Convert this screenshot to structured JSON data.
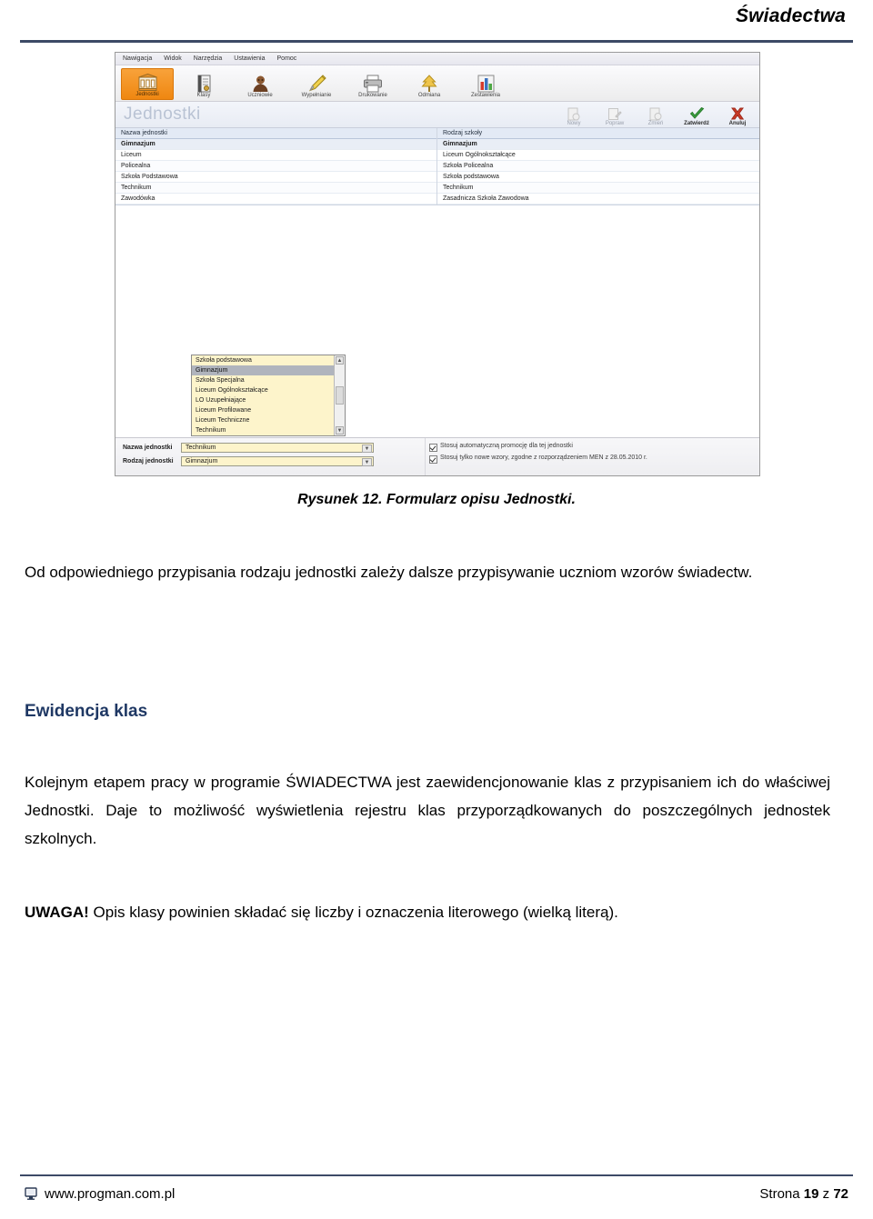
{
  "header": {
    "title": "Świadectwa"
  },
  "figure": {
    "menubar": [
      "Nawigacja",
      "Widok",
      "Narzędzia",
      "Ustawienia",
      "Pomoc"
    ],
    "toolbar": [
      {
        "label": "Jednostki",
        "icon": "building-icon",
        "active": true
      },
      {
        "label": "Klasy",
        "icon": "book-icon",
        "active": false
      },
      {
        "label": "Uczniowie",
        "icon": "person-icon",
        "active": false
      },
      {
        "label": "Wypełnianie",
        "icon": "pencil-icon",
        "active": false
      },
      {
        "label": "Drukowanie",
        "icon": "printer-icon",
        "active": false
      },
      {
        "label": "Odmiana",
        "icon": "tree-icon",
        "active": false
      },
      {
        "label": "Zestawienia",
        "icon": "bar-chart-icon",
        "active": false
      }
    ],
    "window_title": "Jednostki",
    "actions": [
      {
        "label": "Nowy",
        "icon": "new-record-icon",
        "enabled": false
      },
      {
        "label": "Popraw",
        "icon": "edit-record-icon",
        "enabled": false
      },
      {
        "label": "Zmień",
        "icon": "delete-record-icon",
        "enabled": false
      },
      {
        "label": "Zatwierdź",
        "icon": "green-check-icon",
        "enabled": true
      },
      {
        "label": "Anuluj",
        "icon": "red-cross-icon",
        "enabled": true
      }
    ],
    "grid": {
      "columns": [
        "Nazwa jednostki",
        "Rodzaj szkoły"
      ],
      "rows": [
        {
          "nazwa": "Gimnazjum",
          "rodzaj": "Gimnazjum",
          "selected": true
        },
        {
          "nazwa": "Liceum",
          "rodzaj": "Liceum Ogólnokształcące",
          "selected": false
        },
        {
          "nazwa": "Policealna",
          "rodzaj": "Szkoła Policealna",
          "selected": false
        },
        {
          "nazwa": "Szkoła Podstawowa",
          "rodzaj": "Szkoła podstawowa",
          "selected": false
        },
        {
          "nazwa": "Technikum",
          "rodzaj": "Technikum",
          "selected": false
        },
        {
          "nazwa": "Zawodówka",
          "rodzaj": "Zasadnicza Szkoła Zawodowa",
          "selected": false
        }
      ]
    },
    "dropdown": {
      "options": [
        {
          "label": "Szkoła podstawowa",
          "selected": false
        },
        {
          "label": "Gimnazjum",
          "selected": true
        },
        {
          "label": "Szkoła Specjalna",
          "selected": false
        },
        {
          "label": "Liceum Ogólnokształcące",
          "selected": false
        },
        {
          "label": "LO Uzupełniające",
          "selected": false
        },
        {
          "label": "Liceum Profilowane",
          "selected": false
        },
        {
          "label": "Liceum Techniczne",
          "selected": false
        },
        {
          "label": "Technikum",
          "selected": false
        }
      ],
      "scroll_up_glyph": "▲",
      "scroll_down_glyph": "▼"
    },
    "form": {
      "field_nazwa_label": "Nazwa jednostki",
      "field_nazwa_value": "Technikum",
      "field_rodzaj_label": "Rodzaj jednostki",
      "field_rodzaj_value": "Gimnazjum",
      "caret_glyph": "▼",
      "checkbox_1": "Stosuj automatyczną promocję dla tej jednostki",
      "checkbox_2": "Stosuj tylko nowe wzory, zgodne z rozporządzeniem MEN z 28.05.2010 r."
    }
  },
  "caption": "Rysunek 12. Formularz opisu Jednostki.",
  "body": {
    "paragraph_1": "Od odpowiedniego przypisania rodzaju jednostki zależy dalsze przypisywanie uczniom wzorów świadectw.",
    "heading": "Ewidencja klas",
    "paragraph_2": "Kolejnym etapem pracy w programie ŚWIADECTWA jest zaewidencjonowanie klas z przypisaniem ich do właściwej Jednostki. Daje to możliwość wyświetlenia rejestru klas przyporządkowanych do poszczególnych jednostek szkolnych.",
    "paragraph_3_bold": "UWAGA!",
    "paragraph_3_rest": " Opis klasy powinien składać się liczby i oznaczenia literowego (wielką literą)."
  },
  "footer": {
    "website": "www.progman.com.pl",
    "page_prefix": "Strona",
    "page_number": "19",
    "page_middle": "z",
    "page_total": "72"
  },
  "colors": {
    "rule": "#3c4a66",
    "heading": "#1f3864",
    "accent_orange": "#ef8711",
    "combo_yellow": "#fdf4cb"
  }
}
